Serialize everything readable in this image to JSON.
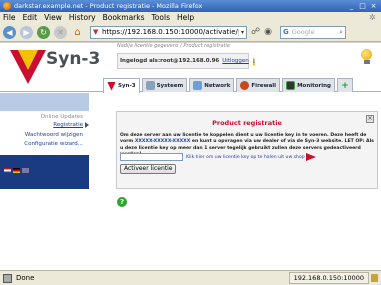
{
  "window": {
    "title": "darkstar.example.net - Product registratie - Mozilla Firefox",
    "controls": [
      "_",
      "□",
      "×"
    ]
  },
  "menubar": {
    "items": [
      {
        "label": "File",
        "key": "F"
      },
      {
        "label": "Edit",
        "key": "E"
      },
      {
        "label": "View",
        "key": "V"
      },
      {
        "label": "History",
        "key": "s"
      },
      {
        "label": "Bookmarks",
        "key": "B"
      },
      {
        "label": "Tools",
        "key": "T"
      },
      {
        "label": "Help",
        "key": "H"
      }
    ]
  },
  "toolbar": {
    "url": "https://192.168.0.150:10000/activatie/registe",
    "search_placeholder": "Google",
    "search_engine_glyph": "G"
  },
  "header": {
    "brand": "Syn-3",
    "caption": "Nadija licentie gegevens / Product registratie",
    "logged_in_text": "Ingelogd als:root@192.168.0.96",
    "logout_label": "Uitloggen"
  },
  "tabs": [
    {
      "label": "Syn-3",
      "icon": "syn3-icon",
      "active": true
    },
    {
      "label": "Systeem",
      "icon": "system-icon",
      "active": false
    },
    {
      "label": "Network",
      "icon": "network-icon",
      "active": false
    },
    {
      "label": "Firewall",
      "icon": "firewall-icon",
      "active": false
    },
    {
      "label": "Monitoring",
      "icon": "monitoring-icon",
      "active": false
    },
    {
      "label": "+",
      "icon": "add-tab-icon",
      "active": false
    }
  ],
  "sidebar": {
    "section": "Online Updates",
    "items": [
      {
        "label": "Registratie"
      },
      {
        "label": "Wachtwoord wijzigen"
      },
      {
        "label": "Configuratie wizard..."
      }
    ]
  },
  "panel": {
    "title": "Product registratie",
    "close_glyph": "×",
    "description_1": "Om deze server aan uw licentie te koppelen dient u uw licentie key in te voeren. Deze heeft de vorm",
    "description_key_format": "XXXXX-XXXXX-XXXXX",
    "description_2": " en kunt u opvragen via uw dealer of via de Syn-3 website. LET OP: Als u deze licentie key op meer dan 1 server tegelijk gebruikt zullen deze servers gedeactiveerd worden!",
    "key_value": "",
    "hint": "Klik hier om uw licentie key op te halen uit uw shop",
    "activate_label": "Activeer licentie",
    "help_glyph": "?"
  },
  "statusbar": {
    "status": "Done",
    "host": "192.168.0.150:10000"
  },
  "colors": {
    "brand_red": "#c8102e",
    "link_blue": "#1c3fa8",
    "titlebar_blue": "#2f63b6",
    "sidebar_navy": "#1a3a82"
  }
}
